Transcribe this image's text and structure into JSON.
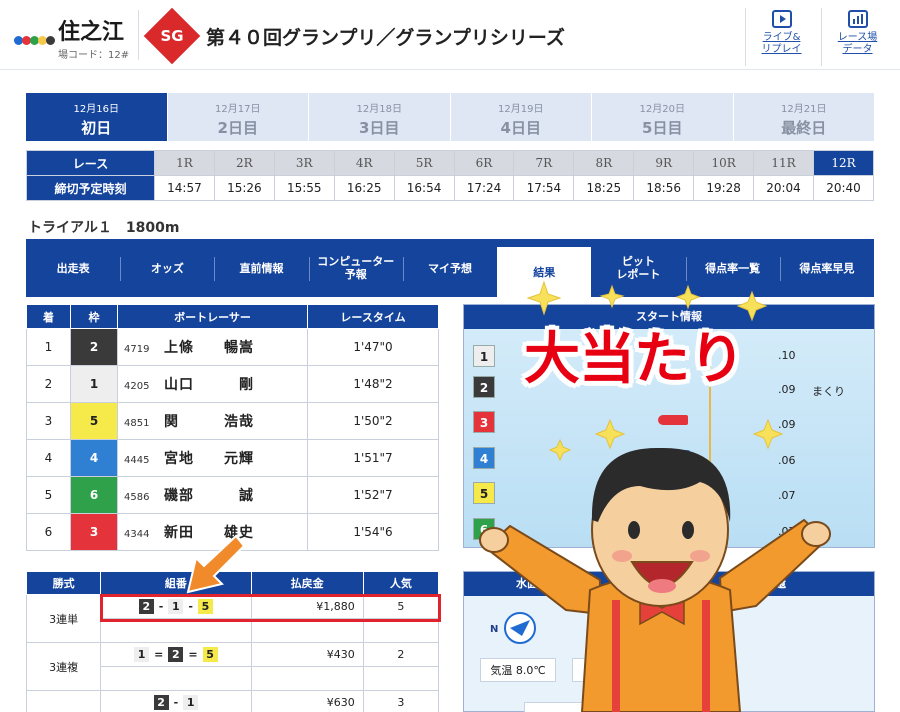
{
  "header": {
    "venue_name": "住之江",
    "venue_code": "場コード：12#",
    "grade": "SG",
    "series_title": "第４０回グランプリ／グランプリシリーズ",
    "buttons": [
      {
        "label_line1": "ライブ&",
        "label_line2": "リプレイ",
        "icon": "tv-icon"
      },
      {
        "label_line1": "レース場",
        "label_line2": "データ",
        "icon": "data-chart-icon"
      }
    ]
  },
  "days": [
    {
      "date": "12月16日",
      "name": "初日",
      "active": true
    },
    {
      "date": "12月17日",
      "name": "2日目",
      "active": false
    },
    {
      "date": "12月18日",
      "name": "3日目",
      "active": false
    },
    {
      "date": "12月19日",
      "name": "4日目",
      "active": false
    },
    {
      "date": "12月20日",
      "name": "5日目",
      "active": false
    },
    {
      "date": "12月21日",
      "name": "最終日",
      "active": false
    }
  ],
  "races": {
    "race_label": "レース",
    "deadline_label": "締切予定時刻",
    "numbers": [
      "1R",
      "2R",
      "3R",
      "4R",
      "5R",
      "6R",
      "7R",
      "8R",
      "9R",
      "10R",
      "11R",
      "12R"
    ],
    "times": [
      "14:57",
      "15:26",
      "15:55",
      "16:25",
      "16:54",
      "17:24",
      "17:54",
      "18:25",
      "18:56",
      "19:28",
      "20:04",
      "20:40"
    ],
    "active_index": 11
  },
  "race_title": "トライアル１　1800m",
  "nav_tabs": [
    {
      "label": "出走表",
      "active": false
    },
    {
      "label": "オッズ",
      "active": false
    },
    {
      "label": "直前情報",
      "active": false
    },
    {
      "label": "コンピューター\n予報",
      "active": false
    },
    {
      "label": "マイ予想",
      "active": false
    },
    {
      "label": "結果",
      "active": true
    },
    {
      "label": "ピット\nレポート",
      "active": false
    },
    {
      "label": "得点率一覧",
      "active": false
    },
    {
      "label": "得点率早見",
      "active": false
    }
  ],
  "results": {
    "headers": [
      "着",
      "枠",
      "ボートレーサー",
      "レースタイム"
    ],
    "rows": [
      {
        "rank": "1",
        "frame": "2",
        "id": "4719",
        "name": "上條　　暢嵩",
        "time": "1'47\"0"
      },
      {
        "rank": "2",
        "frame": "1",
        "id": "4205",
        "name": "山口　　　剛",
        "time": "1'48\"2"
      },
      {
        "rank": "3",
        "frame": "5",
        "id": "4851",
        "name": "関　　　浩哉",
        "time": "1'50\"2"
      },
      {
        "rank": "4",
        "frame": "4",
        "id": "4445",
        "name": "宮地　　元輝",
        "time": "1'51\"7"
      },
      {
        "rank": "5",
        "frame": "6",
        "id": "4586",
        "name": "磯部　　　誠",
        "time": "1'52\"7"
      },
      {
        "rank": "6",
        "frame": "3",
        "id": "4344",
        "name": "新田　　雄史",
        "time": "1'54\"6"
      }
    ]
  },
  "frame_colors": {
    "1": {
      "bg": "#eeeeee",
      "fg": "#222222"
    },
    "2": {
      "bg": "#3a3a3a",
      "fg": "#ffffff"
    },
    "3": {
      "bg": "#e4333b",
      "fg": "#ffffff"
    },
    "4": {
      "bg": "#2f7fd3",
      "fg": "#ffffff"
    },
    "5": {
      "bg": "#f6e94a",
      "fg": "#222222"
    },
    "6": {
      "bg": "#2fa14a",
      "fg": "#ffffff"
    }
  },
  "start_info": {
    "title": "スタート情報",
    "entries": [
      {
        "frame": "1",
        "st": ".10",
        "note": ""
      },
      {
        "frame": "2",
        "st": ".09",
        "note": "まくり"
      },
      {
        "frame": "3",
        "st": ".09",
        "note": ""
      },
      {
        "frame": "4",
        "st": ".06",
        "note": ""
      },
      {
        "frame": "5",
        "st": ".07",
        "note": ""
      },
      {
        "frame": "6",
        "st": ".07",
        "note": ""
      }
    ]
  },
  "payout": {
    "headers": [
      "勝式",
      "組番",
      "払戻金",
      "人気"
    ],
    "rows": [
      {
        "kind": "3連単",
        "combo": [
          "2",
          "1",
          "5"
        ],
        "sep": "-",
        "amount": "¥1,880",
        "popularity": "5"
      },
      {
        "kind": "3連複",
        "combo": [
          "1",
          "2",
          "5"
        ],
        "sep": "=",
        "amount": "¥430",
        "popularity": "2"
      },
      {
        "kind": "",
        "combo": [
          "2",
          "1"
        ],
        "sep": "-",
        "amount": "¥630",
        "popularity": "3"
      }
    ]
  },
  "weather": {
    "title_left": "水面",
    "title_right": "返還",
    "compass_label": "N",
    "temperature": "気温 8.0℃"
  },
  "overlay": {
    "text": "大当たり"
  }
}
